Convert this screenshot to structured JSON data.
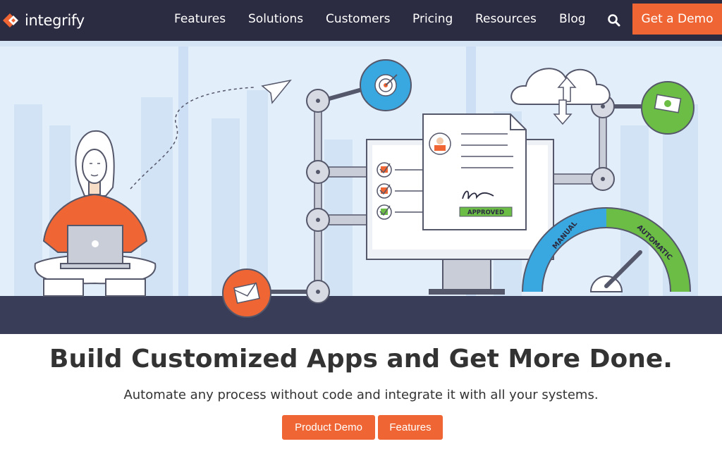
{
  "brand": {
    "name": "integrify"
  },
  "nav": {
    "items": [
      {
        "label": "Features"
      },
      {
        "label": "Solutions"
      },
      {
        "label": "Customers"
      },
      {
        "label": "Pricing"
      },
      {
        "label": "Resources"
      },
      {
        "label": "Blog"
      }
    ],
    "cta_label": "Get a Demo"
  },
  "hero": {
    "document_badge": "APPROVED",
    "gauge_left": "MANUAL",
    "gauge_right": "AUTOMATIC"
  },
  "main": {
    "headline": "Build Customized Apps and Get More Done.",
    "subheadline": "Automate any process without code and integrate it with all your systems.",
    "buttons": {
      "primary": "Product Demo",
      "secondary": "Features"
    }
  },
  "colors": {
    "nav_bg": "#2b2b41",
    "accent": "#ef6533",
    "hero_sky": "#e3eefb",
    "floor": "#3a3d58",
    "gauge_blue": "#3aa8e0",
    "gauge_green": "#6cbd45"
  }
}
